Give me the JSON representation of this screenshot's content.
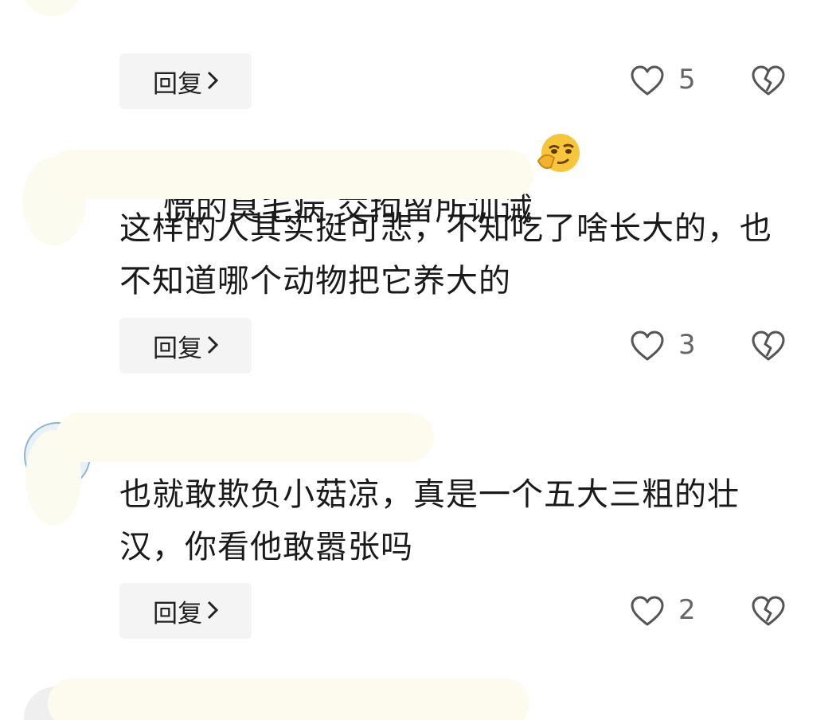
{
  "comments": [
    {
      "text_line1": "惯的臭毛病 交拘留所训诫",
      "reply_label": "回复",
      "like_count": "5"
    },
    {
      "text": "这样的人其实挺可悲，不知吃了啥长大的，也不知道哪个动物把它养大的",
      "reply_label": "回复",
      "like_count": "3"
    },
    {
      "text": "也就敢欺负小菇凉，真是一个五大三粗的壮汉，你看他敢嚣张吗",
      "reply_label": "回复",
      "like_count": "2"
    }
  ],
  "icons": {
    "like": "heart-outline-icon",
    "dislike": "broken-heart-icon",
    "reply_chevron": "chevron-right-icon",
    "emoji": "smirk-thinking-emoji-icon"
  },
  "colors": {
    "text": "#1a1a1a",
    "secondary_text": "#666666",
    "icon_stroke": "#555555",
    "reply_bg": "#f4f4f4",
    "mask": "#fdfbee"
  }
}
